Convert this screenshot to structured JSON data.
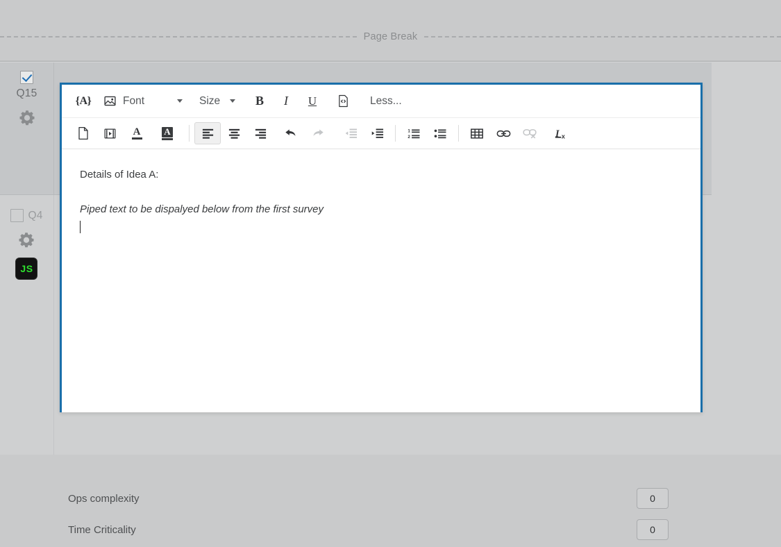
{
  "page_break": {
    "label": "Page Break"
  },
  "questions": [
    {
      "id": "q15",
      "label": "Q15",
      "checked": true,
      "gear_icon": "gear-icon"
    },
    {
      "id": "q4",
      "label": "Q4",
      "checked": false,
      "gear_icon": "gear-icon",
      "js_badge": "JS"
    }
  ],
  "editor": {
    "toolbar": {
      "row1": [
        {
          "name": "rich-content-icon",
          "type": "icon",
          "glyph": "{A}"
        },
        {
          "name": "insert-image-icon",
          "type": "icon"
        },
        {
          "name": "font-dropdown",
          "type": "dropdown",
          "label": "Font"
        },
        {
          "name": "size-dropdown",
          "type": "dropdown",
          "label": "Size"
        },
        {
          "name": "bold-button",
          "type": "text",
          "label": "B"
        },
        {
          "name": "italic-button",
          "type": "text",
          "label": "I"
        },
        {
          "name": "underline-button",
          "type": "text",
          "label": "U"
        },
        {
          "name": "source-code-icon",
          "type": "icon"
        },
        {
          "name": "less-toggle-link",
          "type": "link",
          "label": "Less..."
        }
      ],
      "row2": [
        {
          "name": "insert-file-icon"
        },
        {
          "name": "insert-video-icon"
        },
        {
          "name": "text-color-icon"
        },
        {
          "name": "highlight-color-icon"
        },
        {
          "name": "align-left-button",
          "active": true
        },
        {
          "name": "align-center-button"
        },
        {
          "name": "align-right-button"
        },
        {
          "name": "undo-button"
        },
        {
          "name": "redo-button",
          "disabled": true
        },
        {
          "name": "outdent-button",
          "disabled": true
        },
        {
          "name": "indent-button"
        },
        {
          "name": "numbered-list-button"
        },
        {
          "name": "bulleted-list-button"
        },
        {
          "name": "insert-table-button"
        },
        {
          "name": "insert-link-button"
        },
        {
          "name": "remove-link-button",
          "disabled": true
        },
        {
          "name": "clear-formatting-button"
        }
      ]
    },
    "content": {
      "line1": "Details of Idea A:",
      "line2": "Piped text to be dispalyed below from the first survey"
    }
  },
  "fields": [
    {
      "label": "Ops complexity",
      "value": "0"
    },
    {
      "label": "Time Criticality",
      "value": "0"
    }
  ],
  "colors": {
    "focus_border": "#1a6faa",
    "page_bg": "#cfd0d1",
    "block_bg": "#c4c6c8",
    "editor_bg": "#ffffff",
    "checkbox_check": "#1f6fb5",
    "js_badge_text": "#2ee02e"
  }
}
